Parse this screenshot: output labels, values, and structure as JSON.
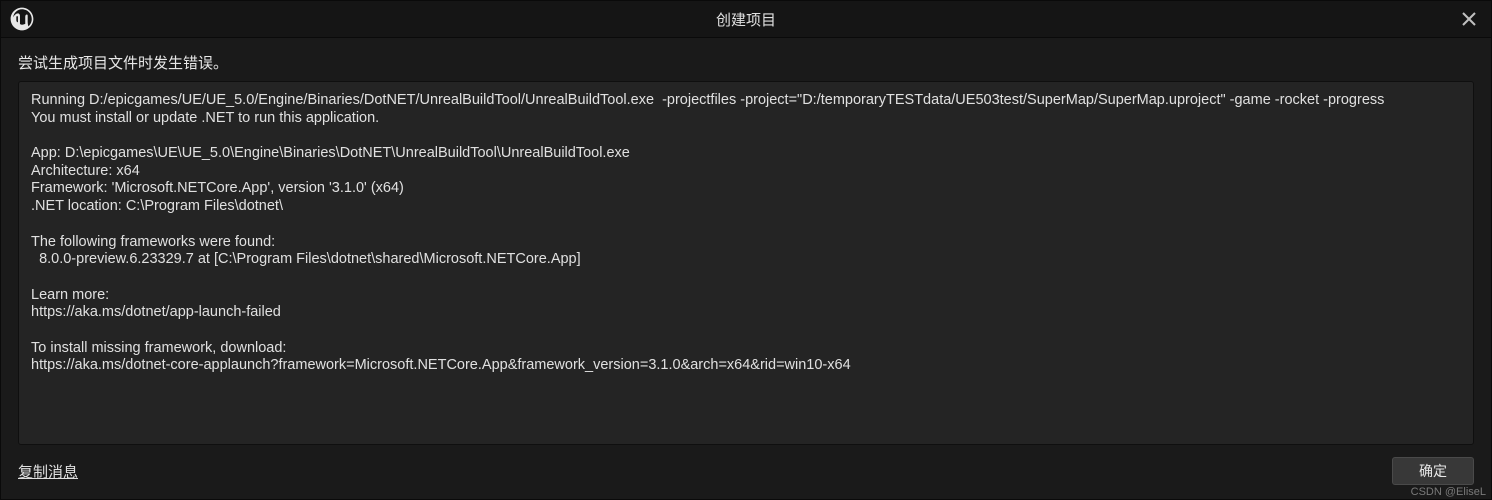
{
  "titlebar": {
    "title": "创建项目"
  },
  "error": {
    "heading": "尝试生成项目文件时发生错误。"
  },
  "log": {
    "content": "Running D:/epicgames/UE/UE_5.0/Engine/Binaries/DotNET/UnrealBuildTool/UnrealBuildTool.exe  -projectfiles -project=\"D:/temporaryTESTdata/UE503test/SuperMap/SuperMap.uproject\" -game -rocket -progress\nYou must install or update .NET to run this application.\n\nApp: D:\\epicgames\\UE\\UE_5.0\\Engine\\Binaries\\DotNET\\UnrealBuildTool\\UnrealBuildTool.exe\nArchitecture: x64\nFramework: 'Microsoft.NETCore.App', version '3.1.0' (x64)\n.NET location: C:\\Program Files\\dotnet\\\n\nThe following frameworks were found:\n  8.0.0-preview.6.23329.7 at [C:\\Program Files\\dotnet\\shared\\Microsoft.NETCore.App]\n\nLearn more:\nhttps://aka.ms/dotnet/app-launch-failed\n\nTo install missing framework, download:\nhttps://aka.ms/dotnet-core-applaunch?framework=Microsoft.NETCore.App&framework_version=3.1.0&arch=x64&rid=win10-x64"
  },
  "footer": {
    "copy_label": "复制消息",
    "ok_label": "确定"
  },
  "watermark": "CSDN @EliseL"
}
